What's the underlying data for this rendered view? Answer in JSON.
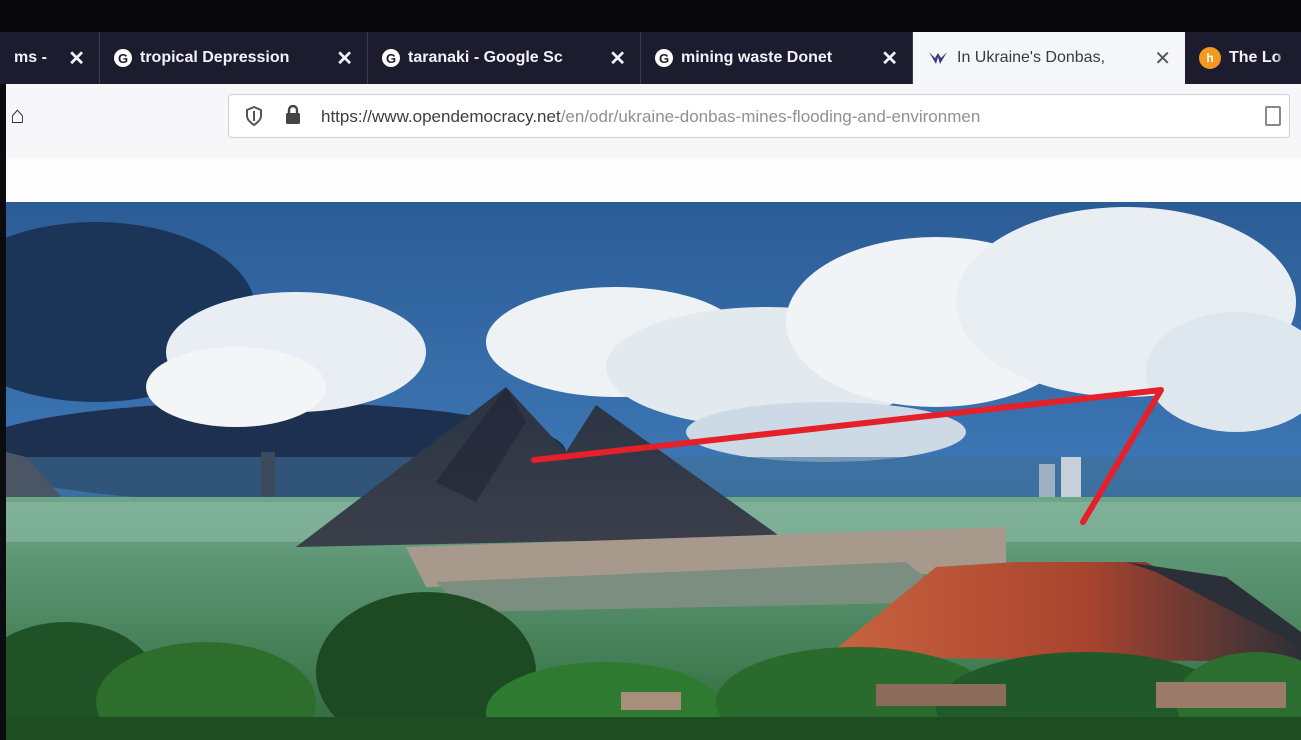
{
  "tabs": [
    {
      "title": "ms - ",
      "icon": "generic-icon",
      "active": false
    },
    {
      "title": "tropical Depression ",
      "icon": "google-icon",
      "active": false
    },
    {
      "title": "taranaki - Google Sc",
      "icon": "google-icon",
      "active": false
    },
    {
      "title": "mining waste Donet",
      "icon": "google-icon",
      "active": false
    },
    {
      "title": "In Ukraine's Donbas,",
      "icon": "opendemocracy-icon",
      "active": true
    },
    {
      "title": "The Lo",
      "icon": "orange-circle-icon",
      "active": false
    }
  ],
  "close_glyph": "✕",
  "nav": {
    "home_icon": "home-icon",
    "url_main": "https://www.opendemocracy.net",
    "url_path": "/en/odr/ukraine-donbas-mines-flooding-and-environmen"
  },
  "colors": {
    "tabstrip": "#1c1c2e",
    "active_tab": "#f5f6fa",
    "annotation_line": "#e5202a",
    "sky": "#24508a"
  },
  "hero_image": {
    "subject": "slag heaps (spoil tips) in Donbas landscape",
    "annotation": "red marker lines drawn over photo"
  }
}
